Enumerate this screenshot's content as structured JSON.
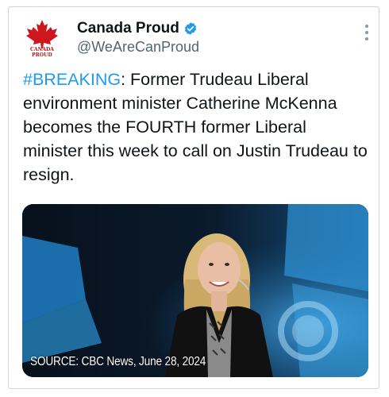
{
  "tweet": {
    "author_name": "Canada Proud",
    "handle": "@WeAreCanProud",
    "logo_text": "CANADA PROUD",
    "hashtag": "#BREAKING",
    "body": ": Former Trudeau Liberal environment minister Catherine McKenna becomes the FOURTH former Liberal minister this week to call on Justin Trudeau to resign.",
    "media_caption": "SOURCE: CBC News, June 28, 2024"
  },
  "colors": {
    "link": "#1d9bf0",
    "verified": "#1d9bf0",
    "text": "#0f1419",
    "secondary": "#536471",
    "maple": "#d0161d"
  },
  "icons": {
    "verified": "verified-badge-icon",
    "more": "more-options-icon",
    "logo": "maple-leaf-icon"
  }
}
